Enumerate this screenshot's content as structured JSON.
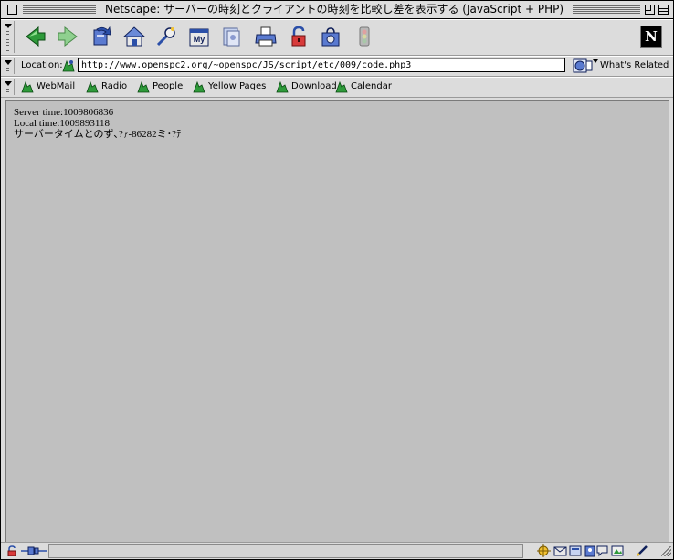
{
  "window": {
    "title": "Netscape: サーバーの時刻とクライアントの時刻を比較し差を表示する (JavaScript + PHP)"
  },
  "navigation_toolbar": {
    "buttons": [
      {
        "name": "back",
        "icon": "back-arrow-icon"
      },
      {
        "name": "forward",
        "icon": "forward-arrow-icon"
      },
      {
        "name": "reload",
        "icon": "reload-icon"
      },
      {
        "name": "home",
        "icon": "home-icon"
      },
      {
        "name": "search",
        "icon": "search-icon"
      },
      {
        "name": "my-netscape",
        "icon": "my-netscape-icon",
        "label": "My"
      },
      {
        "name": "images",
        "icon": "images-icon"
      },
      {
        "name": "print",
        "icon": "print-icon"
      },
      {
        "name": "security",
        "icon": "security-lock-icon"
      },
      {
        "name": "shop",
        "icon": "shop-icon"
      },
      {
        "name": "stop",
        "icon": "stop-icon"
      }
    ],
    "logo": "N"
  },
  "location_bar": {
    "label": "Location:",
    "url": "http://www.openspc2.org/~openspc/JS/script/etc/009/code.php3",
    "whats_related": "What's Related"
  },
  "personal_toolbar": {
    "items": [
      {
        "label": "WebMail"
      },
      {
        "label": "Radio"
      },
      {
        "label": "People"
      },
      {
        "label": "Yellow Pages"
      },
      {
        "label": "Download"
      },
      {
        "label": "Calendar"
      }
    ]
  },
  "page": {
    "lines": [
      "Server time:1009806836",
      "Local time:1009893118",
      "サーバータイムとのず､?ｧ-86282ミ･?ﾃ"
    ]
  },
  "colors": {
    "chrome": "#dcdcdc",
    "content_background": "#c0c0c0",
    "accent_green": "#2e9a3a",
    "accent_blue": "#2b4fa8"
  }
}
